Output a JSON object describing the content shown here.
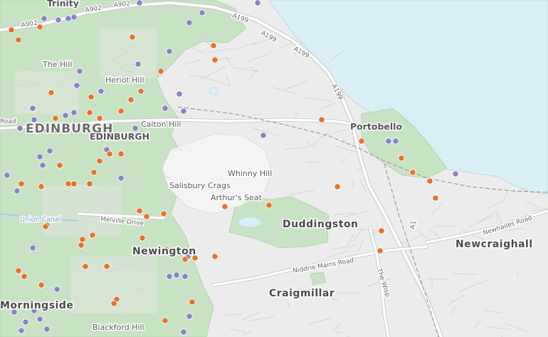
{
  "map": {
    "colors": {
      "land": "#ececec",
      "sea": "#daeef6",
      "green_area": "#c8e3c4",
      "orange_marker": "#e8722a",
      "purple_marker": "#8a82c8"
    },
    "labels": {
      "trinity": "Trinity",
      "edinburgh_large": "EDINBURGH",
      "edinburgh_small": "EDINBURGH",
      "the_hill": "The Hill",
      "heriot_hill": "Heriot Hill",
      "calton_hill": "Calton Hill",
      "salisbury_crags": "Salisbury Crags",
      "whinny_hill": "Whinny Hill",
      "arthurs_seat": "Arthur's Seat",
      "portobello": "Portobello",
      "duddingston": "Duddingston",
      "newcraighall": "Newcraighall",
      "newington": "Newington",
      "craigmillar": "Craigmillar",
      "morningside": "Morningside",
      "blackford_hill": "Blackford Hill",
      "melville_drive": "Melville Drive",
      "union_canal": "Union Canal",
      "road_fragment": "Road",
      "niddrie_mains_road": "Niddrie Mains Road",
      "the_wisp": "The Wisp",
      "newhailes_road": "Newhailes Road",
      "a902_1": "A902",
      "a902_2": "A902",
      "a902_3": "A902",
      "a199_1": "A199",
      "a199_2": "A199",
      "a199_3": "A199",
      "a199_4": "A199",
      "a1": "A1"
    }
  }
}
